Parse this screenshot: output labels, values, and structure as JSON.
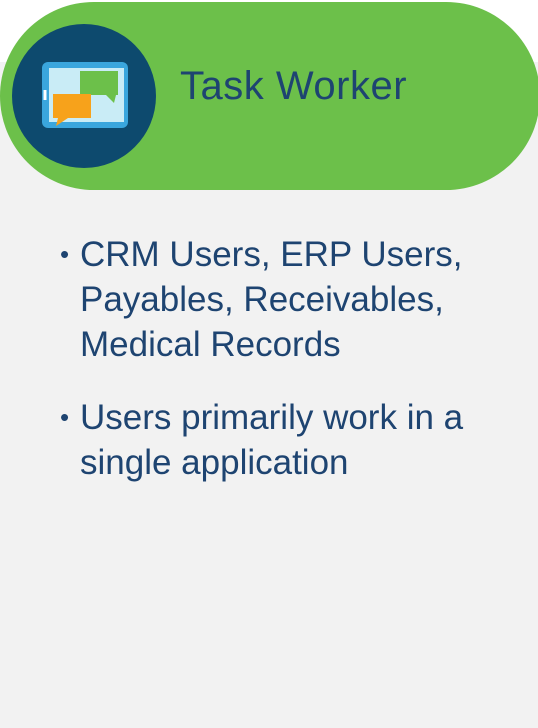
{
  "header": {
    "title": "Task Worker",
    "icon": "chat-bubbles-tablet-icon",
    "accent_color": "#6cc04a",
    "icon_circle_color": "#0d4a6e"
  },
  "content": {
    "bullet_glyph": "•",
    "items": [
      {
        "text": "CRM Users, ERP Users, Payables, Receivables, Medical Records"
      },
      {
        "text": "Users primarily work in a single application"
      }
    ]
  },
  "colors": {
    "text": "#1e4471",
    "card_background": "#f2f2f2"
  }
}
